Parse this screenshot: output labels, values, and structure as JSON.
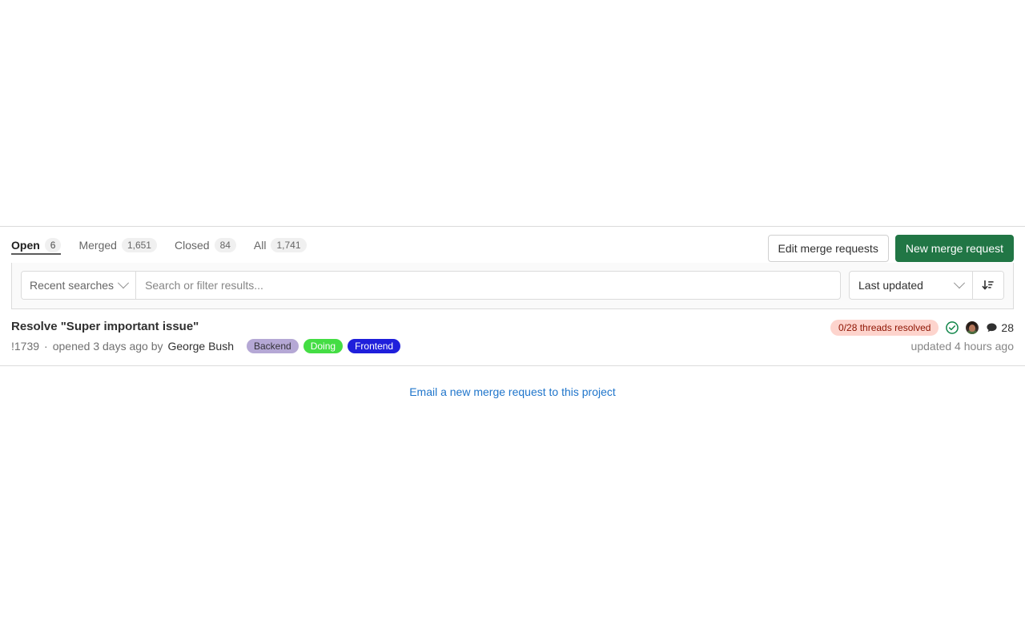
{
  "tabs": [
    {
      "label": "Open",
      "count": "6",
      "active": true
    },
    {
      "label": "Merged",
      "count": "1,651",
      "active": false
    },
    {
      "label": "Closed",
      "count": "84",
      "active": false
    },
    {
      "label": "All",
      "count": "1,741",
      "active": false
    }
  ],
  "actions": {
    "edit_label": "Edit merge requests",
    "new_label": "New merge request",
    "new_color": "#217645"
  },
  "filters": {
    "recent_searches_label": "Recent searches",
    "search_value": "",
    "search_placeholder": "Search or filter results...",
    "sort_selected": "Last updated",
    "sort_direction_icon": "sort-descending-icon"
  },
  "merge_requests": [
    {
      "title": "Resolve \"Super important issue\"",
      "reference": "!1739",
      "separator": "·",
      "opened_text": "opened 3 days ago by",
      "author": "George Bush",
      "labels": [
        {
          "name": "Backend",
          "bg": "#b5a8d5",
          "fg": "#333238"
        },
        {
          "name": "Doing",
          "bg": "#44dd44",
          "fg": "#ffffff"
        },
        {
          "name": "Frontend",
          "bg": "#1f1fdb",
          "fg": "#ffffff"
        }
      ],
      "threads_badge": "0/28 threads resolved",
      "threads_badge_bg": "#fdd4cd",
      "threads_badge_fg": "#8d1300",
      "pipeline_status_icon": "check-circle-icon",
      "pipeline_status_color": "#108548",
      "assignee_avatar": "user-avatar",
      "comment_icon": "comment-icon",
      "comment_count": "28",
      "updated_text": "updated 4 hours ago"
    }
  ],
  "email_link": {
    "label": "Email a new merge request to this project",
    "color": "#1f75cb"
  }
}
